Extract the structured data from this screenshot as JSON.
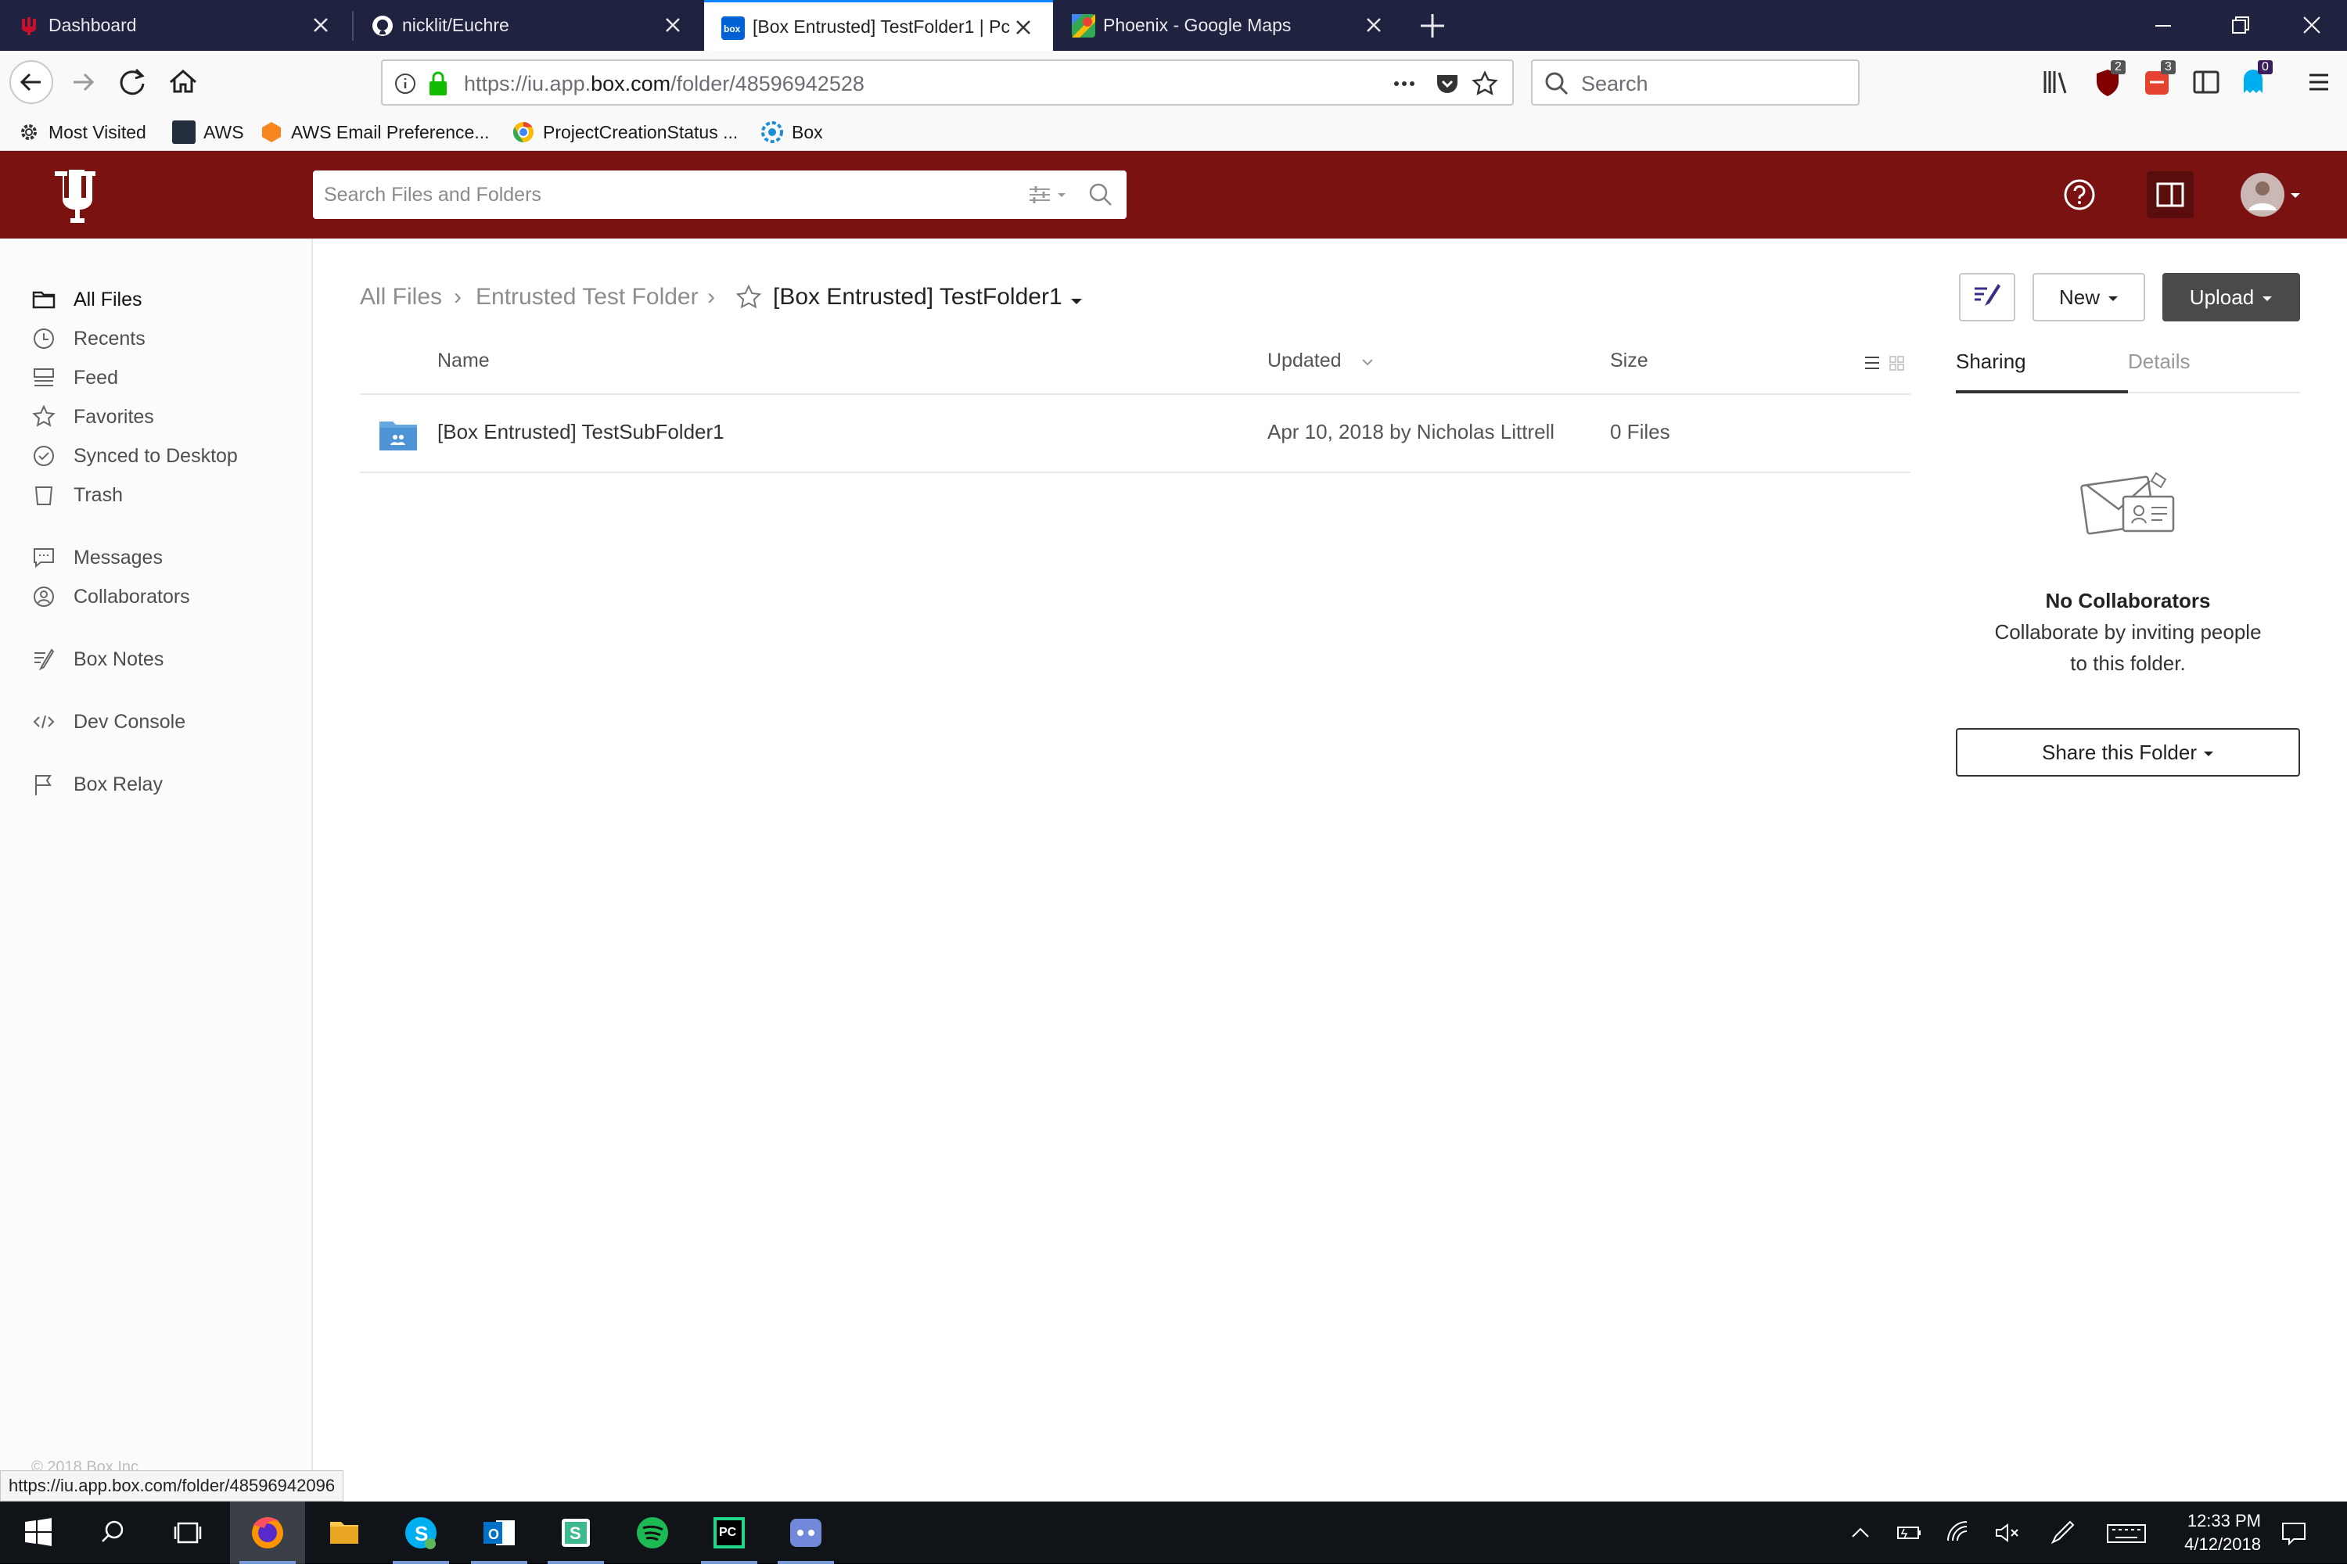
{
  "browser": {
    "tabs": [
      {
        "title": "Dashboard",
        "active": false
      },
      {
        "title": "nicklit/Euchre",
        "active": false
      },
      {
        "title": "[Box Entrusted] TestFolder1 | Pc",
        "active": true
      },
      {
        "title": "Phoenix - Google Maps",
        "active": false
      }
    ],
    "url_prefix": "https://iu.app.",
    "url_domain": "box.com",
    "url_path": "/folder/48596942528",
    "search_placeholder": "Search",
    "badges": {
      "ublock": "2",
      "todoist": "3",
      "ghostery": "0"
    },
    "bookmarks": [
      {
        "label": "Most Visited",
        "icon": "gear-icon"
      },
      {
        "label": "AWS",
        "icon": "aws-icon"
      },
      {
        "label": "AWS Email Preference...",
        "icon": "aws-box-icon"
      },
      {
        "label": "ProjectCreationStatus ...",
        "icon": "chrome-icon"
      },
      {
        "label": "Box",
        "icon": "box-icon"
      }
    ]
  },
  "box": {
    "search_placeholder": "Search Files and Folders",
    "sidebar": {
      "items": [
        {
          "label": "All Files",
          "icon": "folder-icon"
        },
        {
          "label": "Recents",
          "icon": "clock-icon"
        },
        {
          "label": "Feed",
          "icon": "feed-icon"
        },
        {
          "label": "Favorites",
          "icon": "star-icon"
        },
        {
          "label": "Synced to Desktop",
          "icon": "check-circle-icon"
        },
        {
          "label": "Trash",
          "icon": "trash-icon"
        },
        {
          "label": "Messages",
          "icon": "message-icon"
        },
        {
          "label": "Collaborators",
          "icon": "person-circle-icon"
        },
        {
          "label": "Box Notes",
          "icon": "notes-icon"
        },
        {
          "label": "Dev Console",
          "icon": "code-icon"
        },
        {
          "label": "Box Relay",
          "icon": "flag-icon"
        }
      ],
      "footer": "© 2018 Box Inc"
    },
    "breadcrumb": {
      "root": "All Files",
      "parent": "Entrusted Test Folder",
      "current": "[Box Entrusted] TestFolder1"
    },
    "toolbar": {
      "new_label": "New",
      "upload_label": "Upload"
    },
    "table": {
      "headers": {
        "name": "Name",
        "updated": "Updated",
        "size": "Size"
      },
      "rows": [
        {
          "name": "[Box Entrusted] TestSubFolder1",
          "updated": "Apr 10, 2018 by Nicholas Littrell",
          "size": "0 Files"
        }
      ]
    },
    "right_panel": {
      "tabs": [
        "Sharing",
        "Details"
      ],
      "empty_title": "No Collaborators",
      "empty_line1": "Collaborate by inviting people",
      "empty_line2": "to this folder.",
      "share_button": "Share this Folder"
    }
  },
  "status_link": "https://iu.app.box.com/folder/48596942096",
  "taskbar": {
    "time": "12:33 PM",
    "date": "4/12/2018"
  },
  "colors": {
    "box_header": "#7b1212",
    "upload_button": "#4a4a4a",
    "active_tab_accent": "#0a84ff"
  }
}
